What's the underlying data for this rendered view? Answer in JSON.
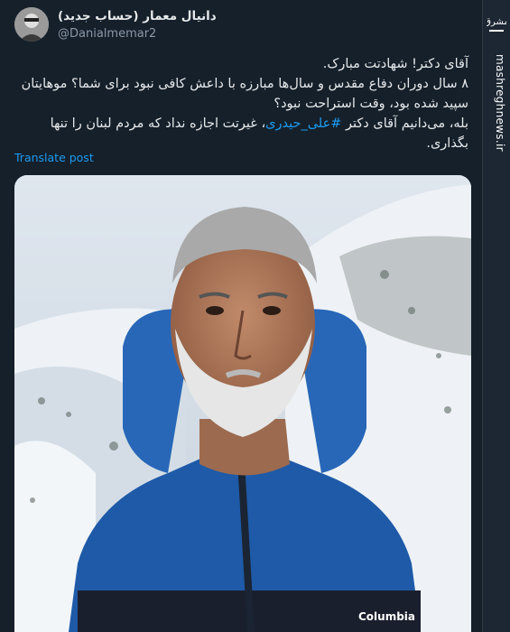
{
  "author": {
    "name": "دانیال معمار (حساب جدید)",
    "handle": "@Danialmemar2"
  },
  "tweet": {
    "line1": "آقای دکتر! شهادتت مبارک.",
    "line2": "۸ سال دوران دفاع مقدس و سال‌ها مبارزه با داعش کافی نبود برای شما؟ موهایتان سپید شده بود، وقت استراحت نبود؟",
    "line3_prefix": "بله، می‌دانیم آقای دکتر",
    "hashtag": "#علی_حیدری",
    "line3_suffix": "، غیرتت اجازه نداد که مردم لبنان را تنها بگذاری."
  },
  "translate_label": "Translate post",
  "watermark": {
    "site": "mashreghnews.ir",
    "logo_text": "مشرق"
  },
  "media": {
    "jacket_brand": "Columbia",
    "description_icon": "portrait-photo"
  },
  "colors": {
    "background": "#15202b",
    "link": "#1d9bf0",
    "text": "#e7e9ea",
    "muted": "#8b98a5"
  }
}
